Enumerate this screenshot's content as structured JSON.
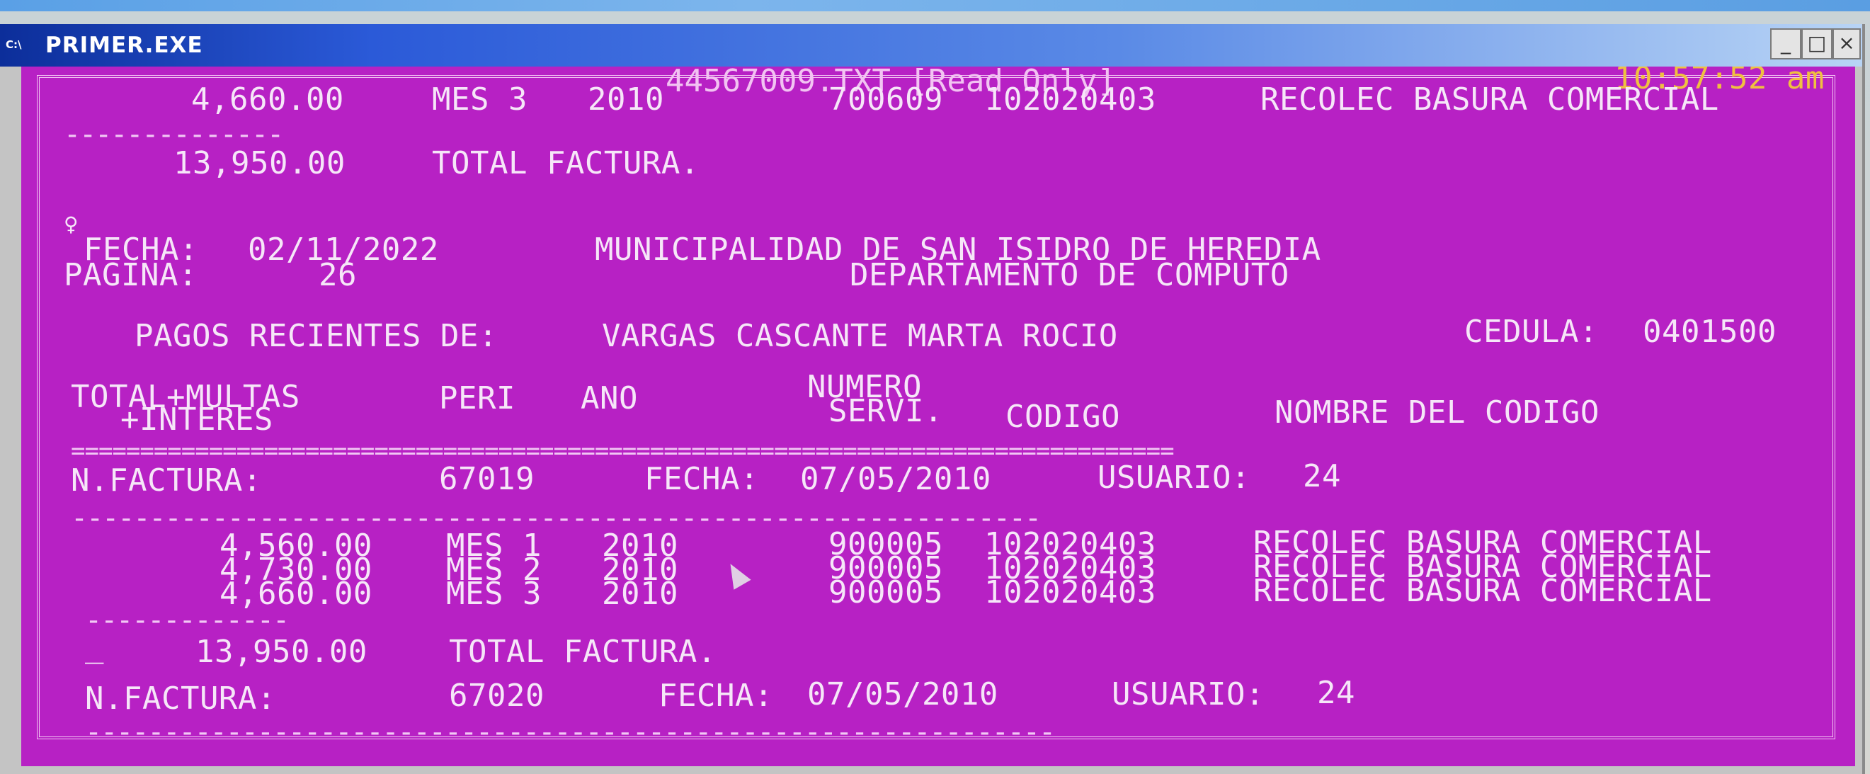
{
  "window": {
    "title": "PRIMER.EXE",
    "icon": "C:\\",
    "min_label": "_",
    "max_label": "□",
    "close_label": "×"
  },
  "screen": {
    "file_label": "44567009.TXT [Read Only]",
    "clock": "10:57:52 am",
    "prev_row": {
      "amount": "4,660.00",
      "period": "MES 3",
      "year": "2010",
      "num": "700609",
      "code": "102020403",
      "name": "RECOLEC BASURA COMERCIAL"
    },
    "dash_short": "--------------",
    "prev_total": {
      "amount": "13,950.00",
      "label": "TOTAL FACTURA."
    },
    "female_symbol": "♀",
    "fecha_label": "FECHA:",
    "fecha_value": "02/11/2022",
    "pagina_label": "PAGINA:",
    "pagina_value": "26",
    "org_name": "MUNICIPALIDAD DE SAN ISIDRO DE HEREDIA",
    "dept_name": "DEPARTAMENTO DE COMPUTO",
    "pagos_label": "PAGOS RECIENTES DE:",
    "pagos_name": "VARGAS CASCANTE MARTA ROCIO",
    "cedula_label": "CEDULA:",
    "cedula_value": "0401500",
    "columns": {
      "total_l1": "TOTAL+MULTAS",
      "total_l2": "+INTERES",
      "peri": "PERI",
      "ano": "ANO",
      "numero_l1": "NUMERO",
      "numero_l2": "SERVI.",
      "codigo": "CODIGO",
      "nombre": "NOMBRE DEL CODIGO"
    },
    "double_rule": "================================================================================",
    "invoice1": {
      "label": "N.FACTURA:",
      "number": "67019",
      "fecha_label": "FECHA:",
      "fecha": "07/05/2010",
      "usuario_label": "USUARIO:",
      "usuario": "24",
      "dash": "--------------------------------------------------------------",
      "rows": [
        {
          "amount": "4,560.00",
          "period": "MES 1",
          "year": "2010",
          "num": "900005",
          "code": "102020403",
          "name": "RECOLEC BASURA COMERCIAL"
        },
        {
          "amount": "4,730.00",
          "period": "MES 2",
          "year": "2010",
          "num": "900005",
          "code": "102020403",
          "name": "RECOLEC BASURA COMERCIAL"
        },
        {
          "amount": "4,660.00",
          "period": "MES 3",
          "year": "2010",
          "num": "900005",
          "code": "102020403",
          "name": "RECOLEC BASURA COMERCIAL"
        }
      ],
      "total_dash": "-------------",
      "underscore": "_",
      "total_amount": "13,950.00",
      "total_label": "TOTAL FACTURA."
    },
    "invoice2": {
      "label": "N.FACTURA:",
      "number": "67020",
      "fecha_label": "FECHA:",
      "fecha": "07/05/2010",
      "usuario_label": "USUARIO:",
      "usuario": "24",
      "dash": "--------------------------------------------------------------"
    }
  }
}
